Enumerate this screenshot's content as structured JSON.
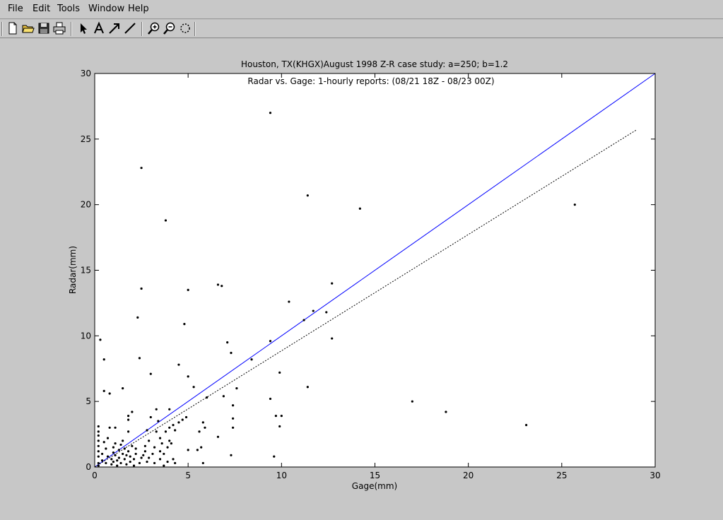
{
  "menu": [
    {
      "label": "File"
    },
    {
      "label": "Edit"
    },
    {
      "label": "Tools"
    },
    {
      "label": "Window"
    },
    {
      "label": "Help"
    }
  ],
  "toolbar": {
    "groups": [
      [
        "new-file-icon",
        "open-folder-icon",
        "save-disk-icon",
        "print-icon"
      ],
      [
        "pointer-arrow-icon",
        "text-insert-icon",
        "arrow-draw-icon",
        "line-draw-icon"
      ],
      [
        "zoom-in-icon",
        "zoom-out-icon",
        "rotate-icon"
      ]
    ]
  },
  "chart_data": {
    "type": "scatter",
    "title": "Houston, TX(KHGX)August 1998 Z-R case study: a=250; b=1.2",
    "subtitle": "Radar vs. Gage: 1-hourly reports: (08/21 18Z - 08/23 00Z)",
    "xlabel": "Gage(mm)",
    "ylabel": "Radar(mm)",
    "xlim": [
      0,
      30
    ],
    "ylim": [
      0,
      30
    ],
    "xticks": [
      "0",
      "5",
      "10",
      "15",
      "20",
      "25",
      "30"
    ],
    "yticks": [
      "0",
      "5",
      "10",
      "15",
      "20",
      "25",
      "30"
    ],
    "grid": false,
    "colors": {
      "points": "#000000",
      "one_to_one": "#0000ff",
      "fit": "#000000",
      "axes_bg": "#ffffff"
    },
    "lines": [
      {
        "style": "solid",
        "color": "#0000ff",
        "x": [
          0,
          30
        ],
        "y": [
          0,
          30
        ]
      },
      {
        "style": "dotted",
        "color": "#000000",
        "x": [
          0,
          29
        ],
        "y": [
          0,
          25.7
        ]
      }
    ],
    "points": [
      [
        0.2,
        0.1
      ],
      [
        0.2,
        0.3
      ],
      [
        0.2,
        0.8
      ],
      [
        0.2,
        1.2
      ],
      [
        0.2,
        1.6
      ],
      [
        0.2,
        2.0
      ],
      [
        0.2,
        2.4
      ],
      [
        0.2,
        2.7
      ],
      [
        0.2,
        3.1
      ],
      [
        0.3,
        9.7
      ],
      [
        0.4,
        0.5
      ],
      [
        0.4,
        1.0
      ],
      [
        0.5,
        1.9
      ],
      [
        0.5,
        8.2
      ],
      [
        0.5,
        5.8
      ],
      [
        0.6,
        0.3
      ],
      [
        0.6,
        1.4
      ],
      [
        0.7,
        0.8
      ],
      [
        0.7,
        2.2
      ],
      [
        0.8,
        5.6
      ],
      [
        0.8,
        3.0
      ],
      [
        0.9,
        0.2
      ],
      [
        0.9,
        0.6
      ],
      [
        1.0,
        1.1
      ],
      [
        1.0,
        1.5
      ],
      [
        1.0,
        0.4
      ],
      [
        1.1,
        1.8
      ],
      [
        1.1,
        0.9
      ],
      [
        1.1,
        3.0
      ],
      [
        1.2,
        0.1
      ],
      [
        1.2,
        0.5
      ],
      [
        1.3,
        1.3
      ],
      [
        1.3,
        0.7
      ],
      [
        1.4,
        1.7
      ],
      [
        1.4,
        0.3
      ],
      [
        1.5,
        1.0
      ],
      [
        1.5,
        2.0
      ],
      [
        1.5,
        6.0
      ],
      [
        1.6,
        0.6
      ],
      [
        1.6,
        1.4
      ],
      [
        1.7,
        0.2
      ],
      [
        1.7,
        0.9
      ],
      [
        1.8,
        1.2
      ],
      [
        1.8,
        2.7
      ],
      [
        1.8,
        3.6
      ],
      [
        1.8,
        3.9
      ],
      [
        1.9,
        0.4
      ],
      [
        1.9,
        0.8
      ],
      [
        2.0,
        4.2
      ],
      [
        2.0,
        1.6
      ],
      [
        2.1,
        0.1
      ],
      [
        2.1,
        0.6
      ],
      [
        2.2,
        1.0
      ],
      [
        2.2,
        1.4
      ],
      [
        2.3,
        11.4
      ],
      [
        2.4,
        8.3
      ],
      [
        2.4,
        0.3
      ],
      [
        2.5,
        0.7
      ],
      [
        2.5,
        22.8
      ],
      [
        2.5,
        13.6
      ],
      [
        2.6,
        0.9
      ],
      [
        2.7,
        1.2
      ],
      [
        2.7,
        1.6
      ],
      [
        2.8,
        0.4
      ],
      [
        2.8,
        2.8
      ],
      [
        2.9,
        0.7
      ],
      [
        2.9,
        2.0
      ],
      [
        3.0,
        3.8
      ],
      [
        3.0,
        7.1
      ],
      [
        3.1,
        1.0
      ],
      [
        3.2,
        0.3
      ],
      [
        3.2,
        1.5
      ],
      [
        3.3,
        2.7
      ],
      [
        3.3,
        4.4
      ],
      [
        3.4,
        3.5
      ],
      [
        3.5,
        0.6
      ],
      [
        3.5,
        1.2
      ],
      [
        3.5,
        2.2
      ],
      [
        3.6,
        1.8
      ],
      [
        3.7,
        0.1
      ],
      [
        3.7,
        1.0
      ],
      [
        3.8,
        18.8
      ],
      [
        3.8,
        2.7
      ],
      [
        3.9,
        0.4
      ],
      [
        3.9,
        1.5
      ],
      [
        4.0,
        2.0
      ],
      [
        4.0,
        3.0
      ],
      [
        4.0,
        4.4
      ],
      [
        4.1,
        1.8
      ],
      [
        4.2,
        0.6
      ],
      [
        4.2,
        3.2
      ],
      [
        4.3,
        2.8
      ],
      [
        4.3,
        0.3
      ],
      [
        4.5,
        3.4
      ],
      [
        4.5,
        7.8
      ],
      [
        4.7,
        3.6
      ],
      [
        4.8,
        10.9
      ],
      [
        4.9,
        3.8
      ],
      [
        5.0,
        6.9
      ],
      [
        5.0,
        1.3
      ],
      [
        5.0,
        13.5
      ],
      [
        5.3,
        6.1
      ],
      [
        5.5,
        1.3
      ],
      [
        5.6,
        2.7
      ],
      [
        5.7,
        1.5
      ],
      [
        5.8,
        3.4
      ],
      [
        5.8,
        0.3
      ],
      [
        5.9,
        3.0
      ],
      [
        6.0,
        5.3
      ],
      [
        6.6,
        13.9
      ],
      [
        6.6,
        2.3
      ],
      [
        6.8,
        13.8
      ],
      [
        6.9,
        5.4
      ],
      [
        7.1,
        9.5
      ],
      [
        7.3,
        8.7
      ],
      [
        7.3,
        0.9
      ],
      [
        7.4,
        4.7
      ],
      [
        7.4,
        3.7
      ],
      [
        7.4,
        3.0
      ],
      [
        7.6,
        6.0
      ],
      [
        8.4,
        8.2
      ],
      [
        9.4,
        27.0
      ],
      [
        9.4,
        9.6
      ],
      [
        9.4,
        5.2
      ],
      [
        9.6,
        0.8
      ],
      [
        9.7,
        3.9
      ],
      [
        9.9,
        7.2
      ],
      [
        9.9,
        3.1
      ],
      [
        10.0,
        3.9
      ],
      [
        10.4,
        12.6
      ],
      [
        11.2,
        11.2
      ],
      [
        11.4,
        6.1
      ],
      [
        11.4,
        20.7
      ],
      [
        11.7,
        11.9
      ],
      [
        12.4,
        11.8
      ],
      [
        12.7,
        14.0
      ],
      [
        12.7,
        9.8
      ],
      [
        14.2,
        19.7
      ],
      [
        17.0,
        5.0
      ],
      [
        18.8,
        4.2
      ],
      [
        23.1,
        3.2
      ],
      [
        25.7,
        20.0
      ]
    ]
  }
}
